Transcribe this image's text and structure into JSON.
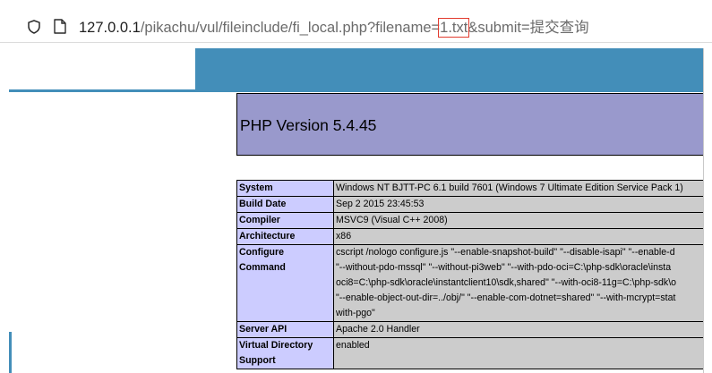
{
  "browser": {
    "url_host": "127.0.0.1",
    "url_path": "/pikachu/vul/fileinclude/fi_local.php?filename=",
    "url_highlight": "1.txt",
    "url_rest": "&submit=提交查询"
  },
  "phpinfo": {
    "title": "PHP Version 5.4.45",
    "rows": [
      {
        "key": "System",
        "value_lines": [
          "Windows NT BJTT-PC 6.1 build 7601 (Windows 7 Ultimate Edition Service Pack 1)"
        ]
      },
      {
        "key": "Build Date",
        "value_lines": [
          "Sep 2 2015 23:45:53"
        ]
      },
      {
        "key": "Compiler",
        "value_lines": [
          "MSVC9 (Visual C++ 2008)"
        ]
      },
      {
        "key": "Architecture",
        "value_lines": [
          "x86"
        ]
      },
      {
        "key": "Configure Command",
        "value_lines": [
          "cscript /nologo configure.js \"--enable-snapshot-build\" \"--disable-isapi\" \"--enable-d",
          "\"--without-pdo-mssql\" \"--without-pi3web\" \"--with-pdo-oci=C:\\php-sdk\\oracle\\insta",
          "oci8=C:\\php-sdk\\oracle\\instantclient10\\sdk,shared\" \"--with-oci8-11g=C:\\php-sdk\\o",
          "\"--enable-object-out-dir=../obj/\" \"--enable-com-dotnet=shared\" \"--with-mcrypt=stat",
          "with-pgo\""
        ]
      },
      {
        "key": "Server API",
        "value_lines": [
          "Apache 2.0 Handler"
        ]
      },
      {
        "key": "Virtual Directory Support",
        "value_lines": [
          "enabled"
        ]
      }
    ]
  },
  "colors": {
    "header_band": "#438eb9",
    "php_header": "#9999cc",
    "key_cell": "#ccccff",
    "value_cell": "#cccccc",
    "url_highlight_box": "#e23b2e"
  },
  "icons": {
    "shield": "shield-icon",
    "page": "page-icon"
  }
}
